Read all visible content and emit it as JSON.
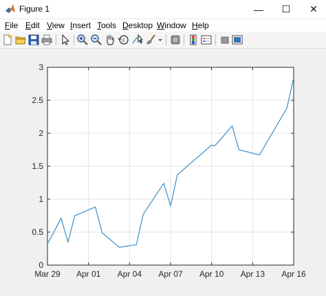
{
  "window": {
    "title": "Figure 1",
    "minimize_glyph": "—",
    "maximize_glyph": "☐",
    "close_glyph": "✕"
  },
  "menu": {
    "items": [
      {
        "label": "File",
        "mnemonic": "F",
        "rest": "ile"
      },
      {
        "label": "Edit",
        "mnemonic": "E",
        "rest": "dit"
      },
      {
        "label": "View",
        "mnemonic": "V",
        "rest": "iew"
      },
      {
        "label": "Insert",
        "mnemonic": "I",
        "rest": "nsert"
      },
      {
        "label": "Tools",
        "mnemonic": "T",
        "rest": "ools"
      },
      {
        "label": "Desktop",
        "mnemonic": "D",
        "rest": "esktop"
      },
      {
        "label": "Window",
        "mnemonic": "W",
        "rest": "indow"
      },
      {
        "label": "Help",
        "mnemonic": "H",
        "rest": "elp"
      }
    ]
  },
  "toolbar": {
    "icons": [
      "new-figure-icon",
      "open-file-icon",
      "save-icon",
      "print-icon",
      "edit-plot-arrow-icon",
      "zoom-in-icon",
      "zoom-out-icon",
      "pan-hand-icon",
      "rotate-3d-icon",
      "data-cursor-icon",
      "brush-icon",
      "brush-dropdown-icon",
      "link-plot-icon",
      "colorbar-icon",
      "legend-icon",
      "hide-plot-tools-icon",
      "show-plot-tools-icon"
    ]
  },
  "colors": {
    "line": "#3b8fc6",
    "grid": "#e3e3e3",
    "axis": "#262626"
  },
  "chart_data": {
    "type": "line",
    "title": "",
    "xlabel": "",
    "ylabel": "",
    "grid": true,
    "xlim": [
      "2020-03-29",
      "2020-04-16"
    ],
    "ylim": [
      0,
      3
    ],
    "xticks": [
      "2020-03-29",
      "2020-04-01",
      "2020-04-04",
      "2020-04-07",
      "2020-04-10",
      "2020-04-13",
      "2020-04-16"
    ],
    "xtick_labels": [
      "Mar 29",
      "Apr 01",
      "Apr 04",
      "Apr 07",
      "Apr 10",
      "Apr 13",
      "Apr 16"
    ],
    "yticks": [
      0,
      0.5,
      1,
      1.5,
      2,
      2.5,
      3
    ],
    "ytick_labels": [
      "0",
      "0.5",
      "1",
      "1.5",
      "2",
      "2.5",
      "3"
    ],
    "series": [
      {
        "x": [
          "2020-03-29",
          "2020-03-30",
          "2020-03-30 12:00",
          "2020-03-31",
          "2020-04-01 12:00",
          "2020-04-02",
          "2020-04-03 06:00",
          "2020-04-04 12:00",
          "2020-04-05",
          "2020-04-06 12:00",
          "2020-04-07",
          "2020-04-07 12:00",
          "2020-04-10",
          "2020-04-10 06:00",
          "2020-04-11 12:00",
          "2020-04-12",
          "2020-04-13 12:00",
          "2020-04-15 12:00",
          "2020-04-16"
        ],
        "y": [
          0.32,
          0.71,
          0.35,
          0.75,
          0.88,
          0.49,
          0.27,
          0.31,
          0.77,
          1.24,
          0.9,
          1.37,
          1.82,
          1.81,
          2.11,
          1.75,
          1.67,
          2.38,
          2.84
        ]
      }
    ]
  }
}
